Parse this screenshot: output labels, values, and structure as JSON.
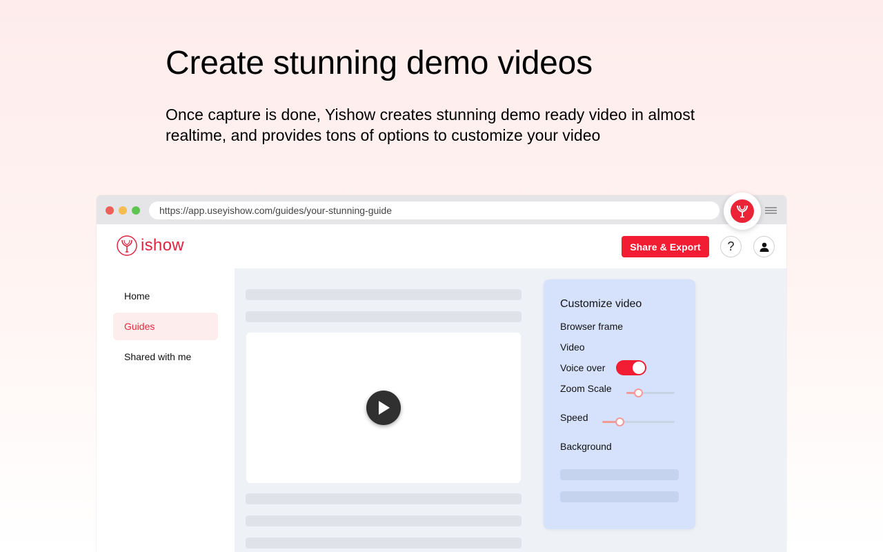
{
  "hero": {
    "headline": "Create stunning demo videos",
    "subtext": "Once capture is done, Yishow creates stunning demo ready video in almost realtime, and provides tons of options to customize your video"
  },
  "browser": {
    "url": "https://app.useyishow.com/guides/your-stunning-guide",
    "extension_icon": "yishow-logo-icon",
    "menu_icon": "hamburger-menu-icon"
  },
  "app": {
    "logo_text": "ishow",
    "share_label": "Share & Export",
    "help_label": "?",
    "user_icon": "user-icon"
  },
  "sidebar": {
    "items": [
      {
        "label": "Home",
        "active": false
      },
      {
        "label": "Guides",
        "active": true
      },
      {
        "label": "Shared with me",
        "active": false
      }
    ]
  },
  "main": {
    "play_icon": "play-icon"
  },
  "customize": {
    "title": "Customize video",
    "browser_frame_label": "Browser frame",
    "video_label": "Video",
    "voice_over_label": "Voice over",
    "voice_over_on": true,
    "zoom_scale_label": "Zoom Scale",
    "zoom_scale_value": 0.25,
    "speed_label": "Speed",
    "speed_value": 0.25,
    "background_label": "Background"
  },
  "colors": {
    "accent": "#f21d32",
    "brand": "#e0233f",
    "panel": "#d6e2fc"
  }
}
